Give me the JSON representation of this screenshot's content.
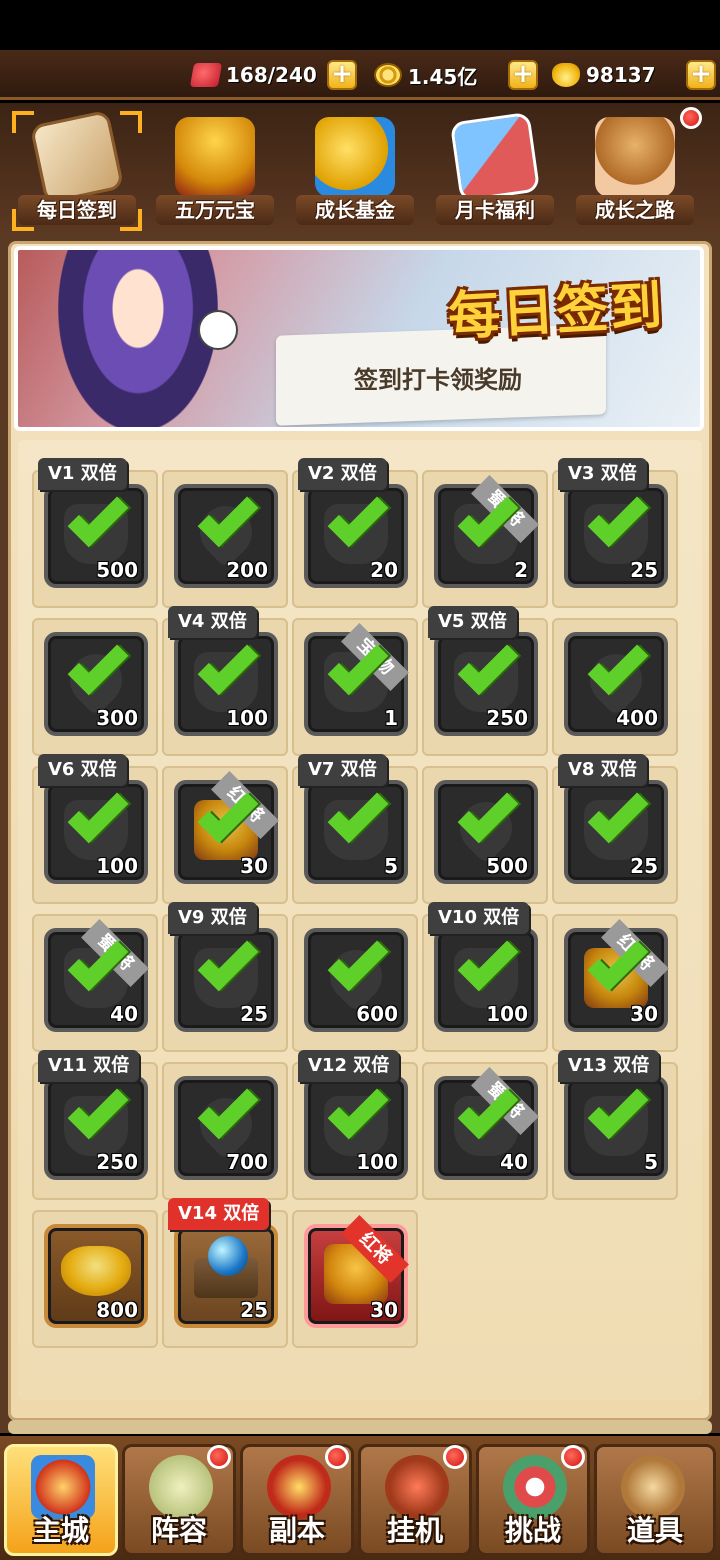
{
  "resources": {
    "stamina": "168/240",
    "coins": "1.45亿",
    "gold": "98137"
  },
  "top_menu": [
    {
      "label": "每日签到",
      "icon": "sign-in-icon",
      "selected": true,
      "dot": false
    },
    {
      "label": "五万元宝",
      "icon": "treasure-chest-icon",
      "selected": false,
      "dot": false
    },
    {
      "label": "成长基金",
      "icon": "growth-fund-icon",
      "selected": false,
      "dot": false
    },
    {
      "label": "月卡福利",
      "icon": "month-card-icon",
      "selected": false,
      "dot": false
    },
    {
      "label": "成长之路",
      "icon": "growth-road-icon",
      "selected": false,
      "dot": true
    }
  ],
  "banner": {
    "title": "每日签到",
    "subtitle": "签到打卡领奖励"
  },
  "rewards": [
    {
      "vip": "V1 双倍",
      "qty": "500",
      "shape": "box",
      "checked": true
    },
    {
      "vip": "",
      "qty": "200",
      "shape": "heart",
      "checked": true
    },
    {
      "vip": "V2 双倍",
      "qty": "20",
      "shape": "ring",
      "checked": true
    },
    {
      "vip": "",
      "qty": "2",
      "shape": "helmet",
      "tag": "蜀 将",
      "checked": true
    },
    {
      "vip": "V3 双倍",
      "qty": "25",
      "shape": "helmet",
      "checked": true
    },
    {
      "vip": "",
      "qty": "300",
      "shape": "heart",
      "checked": true
    },
    {
      "vip": "V4 双倍",
      "qty": "100",
      "shape": "box",
      "checked": true
    },
    {
      "vip": "",
      "qty": "1",
      "shape": "box",
      "tag": "宝 物",
      "checked": true
    },
    {
      "vip": "V5 双倍",
      "qty": "250",
      "shape": "orb",
      "checked": true
    },
    {
      "vip": "",
      "qty": "400",
      "shape": "heart",
      "checked": true
    },
    {
      "vip": "V6 双倍",
      "qty": "100",
      "shape": "box",
      "checked": true
    },
    {
      "vip": "",
      "qty": "30",
      "shape": "chest",
      "tag": "红 将",
      "checked": true
    },
    {
      "vip": "V7 双倍",
      "qty": "5",
      "shape": "box",
      "checked": true
    },
    {
      "vip": "",
      "qty": "500",
      "shape": "heart",
      "checked": true
    },
    {
      "vip": "V8 双倍",
      "qty": "25",
      "shape": "helmet",
      "checked": true
    },
    {
      "vip": "",
      "qty": "40",
      "shape": "helmet",
      "tag": "蜀 将",
      "checked": true
    },
    {
      "vip": "V9 双倍",
      "qty": "25",
      "shape": "helmet",
      "checked": true
    },
    {
      "vip": "",
      "qty": "600",
      "shape": "heart",
      "checked": true
    },
    {
      "vip": "V10 双倍",
      "qty": "100",
      "shape": "box",
      "checked": true
    },
    {
      "vip": "",
      "qty": "30",
      "shape": "chest",
      "tag": "红 将",
      "checked": true
    },
    {
      "vip": "V11 双倍",
      "qty": "250",
      "shape": "orb",
      "checked": true
    },
    {
      "vip": "",
      "qty": "700",
      "shape": "heart",
      "checked": true
    },
    {
      "vip": "V12 双倍",
      "qty": "100",
      "shape": "box",
      "checked": true
    },
    {
      "vip": "",
      "qty": "40",
      "shape": "helmet",
      "tag": "蜀 将",
      "checked": true
    },
    {
      "vip": "V13 双倍",
      "qty": "5",
      "shape": "box",
      "checked": true
    },
    {
      "vip": "",
      "qty": "800",
      "shape": "ingot",
      "checked": false,
      "style": "gold"
    },
    {
      "vip": "V14 双倍",
      "qty": "25",
      "shape": "boxorb",
      "checked": false,
      "style": "box",
      "vip_red": true
    },
    {
      "vip": "",
      "qty": "30",
      "shape": "chest",
      "tag": "红将",
      "checked": false,
      "style": "chest"
    }
  ],
  "bottom_nav": [
    {
      "label": "主城",
      "icon": "main-city-icon",
      "active": true,
      "dot": false
    },
    {
      "label": "阵容",
      "icon": "team-icon",
      "active": false,
      "dot": true
    },
    {
      "label": "副本",
      "icon": "dungeon-icon",
      "active": false,
      "dot": true
    },
    {
      "label": "挂机",
      "icon": "idle-icon",
      "active": false,
      "dot": true
    },
    {
      "label": "挑战",
      "icon": "challenge-icon",
      "active": false,
      "dot": true
    },
    {
      "label": "道具",
      "icon": "items-icon",
      "active": false,
      "dot": false
    }
  ],
  "colors": {
    "check": "#5fcf2a",
    "vip_tag": "#3f3f3f",
    "vip_tag_highlight": "#e0322b",
    "accent_gold": "#f4a21a"
  }
}
